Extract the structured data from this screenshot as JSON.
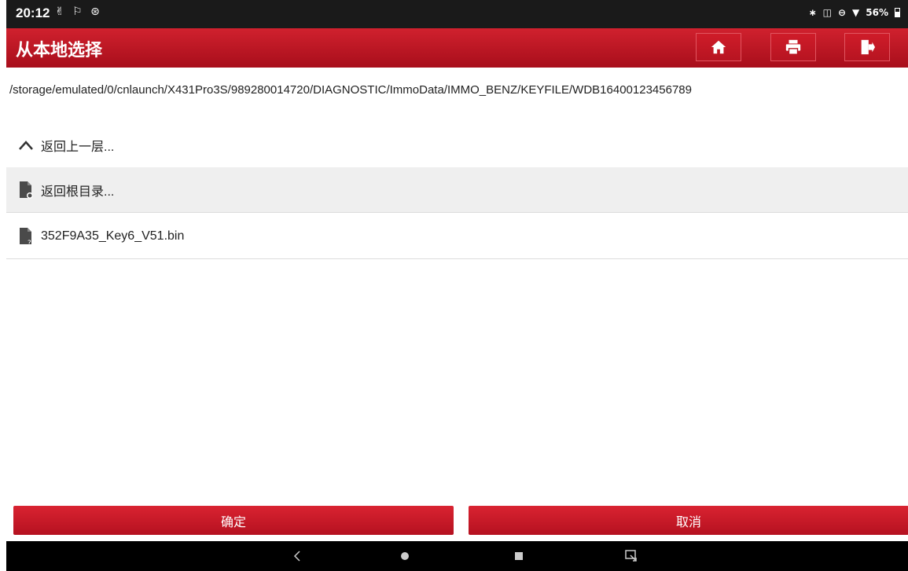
{
  "status_bar": {
    "time": "20:12",
    "left_icons": "✌ ⚐ ⊛",
    "battery_text": "56%",
    "icons": [
      "bluetooth-icon",
      "vibrate-icon",
      "dnd-icon",
      "wifi-icon",
      "battery-icon"
    ]
  },
  "header": {
    "title": "从本地选择",
    "buttons": [
      "home-icon",
      "print-icon",
      "exit-icon"
    ]
  },
  "path": "/storage/emulated/0/cnlaunch/X431Pro3S/989280014720/DIAGNOSTIC/ImmoData/IMMO_BENZ/KEYFILE/WDB16400123456789",
  "list": {
    "up_label": "返回上一层...",
    "root_label": "返回根目录...",
    "file_label": "352F9A35_Key6_V51.bin"
  },
  "actions": {
    "ok_label": "确定",
    "cancel_label": "取消"
  },
  "colors": {
    "brand_red": "#c41a27",
    "status_bar": "#1a1a1a"
  }
}
